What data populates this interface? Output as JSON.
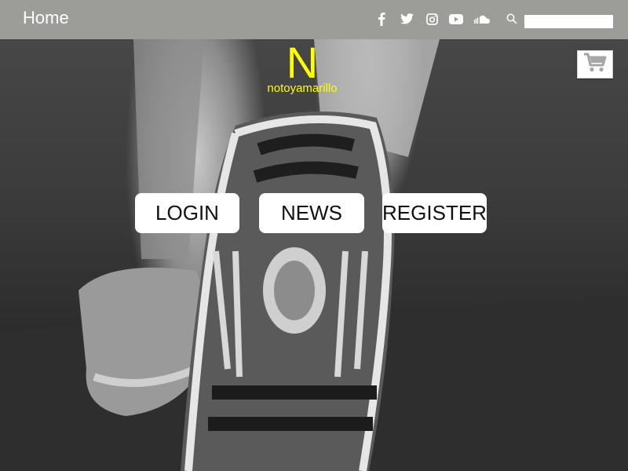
{
  "topbar": {
    "home_label": "Home",
    "social_icons": [
      "facebook-icon",
      "twitter-icon",
      "instagram-icon",
      "youtube-icon",
      "soundcloud-icon"
    ],
    "search": {
      "icon": "search-icon",
      "value": "",
      "placeholder": ""
    }
  },
  "logo": {
    "letter": "N",
    "name": "notoyamarillo"
  },
  "cart": {
    "icon": "shopping-cart-icon"
  },
  "nav": {
    "login_label": "LOGIN",
    "news_label": "NEWS",
    "register_label": "REGISTER"
  },
  "colors": {
    "topbar_bg": "#9c9c98",
    "logo_yellow": "#ffff00",
    "button_bg": "#ffffff",
    "cart_icon_gray": "#a6a6a6"
  }
}
